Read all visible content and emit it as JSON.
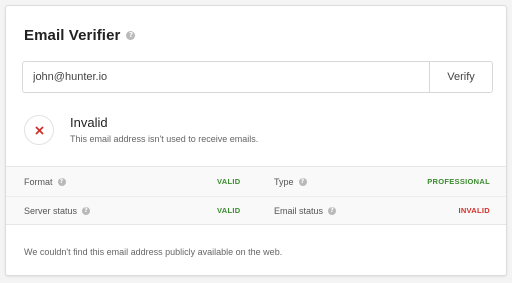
{
  "verifier": {
    "title": "Email Verifier",
    "input_value": "john@hunter.io",
    "verify_label": "Verify"
  },
  "result": {
    "status": "Invalid",
    "description": "This email address isn't used to receive emails."
  },
  "details": {
    "format_label": "Format",
    "format_value": "VALID",
    "type_label": "Type",
    "type_value": "PROFESSIONAL",
    "server_status_label": "Server status",
    "server_status_value": "VALID",
    "email_status_label": "Email status",
    "email_status_value": "INVALID"
  },
  "footer": {
    "message": "We couldn't find this email address publicly available on the web."
  },
  "colors": {
    "valid": "#3b8c2f",
    "invalid": "#d0312d",
    "icon_x": "#d0312d"
  },
  "icons": {
    "help": "question-circle-icon",
    "status": "x-icon"
  }
}
